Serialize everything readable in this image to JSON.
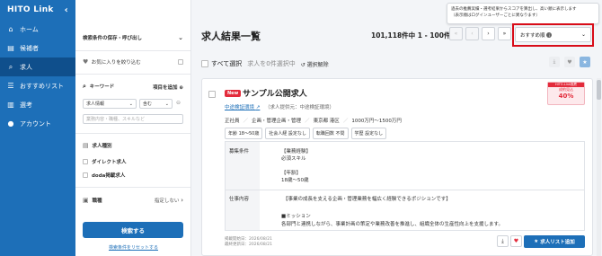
{
  "sidebar": {
    "brand": "HITO Link",
    "collapse_icon": "‹",
    "items": [
      {
        "label": "ホーム",
        "icon": "home-icon",
        "glyph": "⌂"
      },
      {
        "label": "候補者",
        "icon": "candidates-icon",
        "glyph": "▤"
      },
      {
        "label": "求人",
        "icon": "search-icon",
        "glyph": "⌕"
      },
      {
        "label": "おすすめリスト",
        "icon": "list-icon",
        "glyph": "☰"
      },
      {
        "label": "選考",
        "icon": "document-icon",
        "glyph": "▥"
      },
      {
        "label": "アカウント",
        "icon": "person-icon",
        "glyph": "●"
      }
    ],
    "active_index": 2
  },
  "filter": {
    "saved_search_label": "検索条件の保存・呼び出し",
    "favorites_label": "お気に入りを絞り込む",
    "keyword_label": "キーワード",
    "add_item_label": "項目を追加",
    "keyword_field_select": "求人情報",
    "keyword_match_select": "含む",
    "keyword_placeholder": "業務内容・職種、スキルなど",
    "job_type_label": "求人種別",
    "direct_label": "ダイレクト求人",
    "doda_label": "doda掲載求人",
    "occupation_label": "職種",
    "occupation_value": "指定しない",
    "search_button": "検索する",
    "reset_link": "検索条件をリセットする"
  },
  "main": {
    "title": "求人結果一覧",
    "count_text": "101,118件中 1 - 100件",
    "sort_label": "おすすめ順",
    "tooltip_line1": "過去の推薦実績・選考結果からスコアを算出し、高い順に表示します",
    "tooltip_line2": "（表示順はログインユーザーごとに異なります）",
    "select_all": "すべて選択",
    "selected_count": "求人を0件選択中",
    "deselect": "選択解除"
  },
  "card": {
    "new_badge": "New",
    "title": "サンプル公開求人",
    "company": "中途検証環境",
    "provider": "（求人提供元：中途検証環境）",
    "meta": [
      "正社員",
      "企画・管理企画・管理",
      "東京都 港区",
      "1000万円〜1500万円"
    ],
    "tags": [
      "年齢 18〜50歳",
      "社会人経 設定なし",
      "転職回数 不問",
      "学歴 設定なし"
    ],
    "requirements_label": "募集条件",
    "requirements_lines": [
      "【業務経験】",
      "必須スキル",
      "",
      "【年齢】",
      "18歳〜50歳"
    ],
    "duties_label": "仕事内容",
    "duties_intro": "【事業の成長を支える企画・管理業務を幅広く経験できるポジションです】",
    "duties_lines": [
      "■ミッション",
      "各部門と連携しながら、事業計画の策定や業務改善を推進し、組織全体の生産性向上を支援します。"
    ],
    "published": "掲載開始日：2026/08/21",
    "updated": "最終更新日：2026/08/21",
    "add_button": "求人リスト追加",
    "rank_head": "HITO-Link推薦",
    "rank_label": "成約見込",
    "rank_value": "40%"
  }
}
